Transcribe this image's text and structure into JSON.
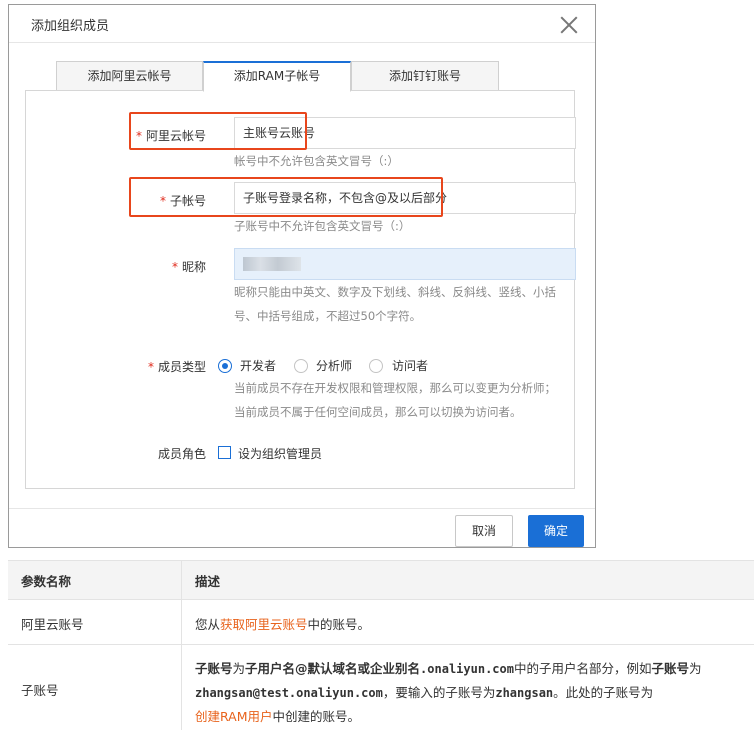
{
  "dialog": {
    "title": "添加组织成员",
    "tabs": [
      "添加阿里云帐号",
      "添加RAM子帐号",
      "添加钉钉账号"
    ],
    "active_tab": 1,
    "fields": {
      "aliyun_account": {
        "label": "阿里云帐号",
        "value": "主账号云账号",
        "hint": "帐号中不允许包含英文冒号（:）"
      },
      "sub_account": {
        "label": "子帐号",
        "value": "子账号登录名称，不包含@及以后部分",
        "hint": "子账号中不允许包含英文冒号（:）"
      },
      "nickname": {
        "label": "昵称",
        "hint_line1": "昵称只能由中英文、数字及下划线、斜线、反斜线、竖线、小括",
        "hint_line2": "号、中括号组成，不超过50个字符。"
      },
      "member_type": {
        "label": "成员类型",
        "options": [
          "开发者",
          "分析师",
          "访问者"
        ],
        "selected": "开发者",
        "hint_line1": "当前成员不存在开发权限和管理权限，那么可以变更为分析师；",
        "hint_line2": "当前成员不属于任何空间成员，那么可以切换为访问者。"
      },
      "member_role": {
        "label": "成员角色",
        "checkbox_label": "设为组织管理员",
        "checked": false
      }
    },
    "required_mark": "*",
    "buttons": {
      "cancel": "取消",
      "confirm": "确定"
    }
  },
  "param_table": {
    "headers": [
      "参数名称",
      "描述"
    ],
    "rows": [
      {
        "name": "阿里云账号",
        "desc_prefix": "您从",
        "desc_link": "获取阿里云账号",
        "desc_suffix": "中的账号。"
      },
      {
        "name": "子账号",
        "p1": "子账号",
        "p2": "为",
        "p3": "子用户名@默认域名或企业别名",
        "p4": ".onaliyun.com",
        "p5": "中的子用户名部分，例如",
        "p6": "子账号",
        "p7": "为",
        "p8": "zhangsan@test.onaliyun.com",
        "p9": "，要输入的子账号为",
        "p10": "zhangsan",
        "p11": "。此处的子账号为",
        "p12": "创建RAM用户",
        "p13": "中创建的账号。"
      }
    ]
  },
  "colors": {
    "primary": "#1a6fd6",
    "required": "#e02b1c",
    "highlight_box": "#e8461c",
    "link": "#e8631c"
  }
}
